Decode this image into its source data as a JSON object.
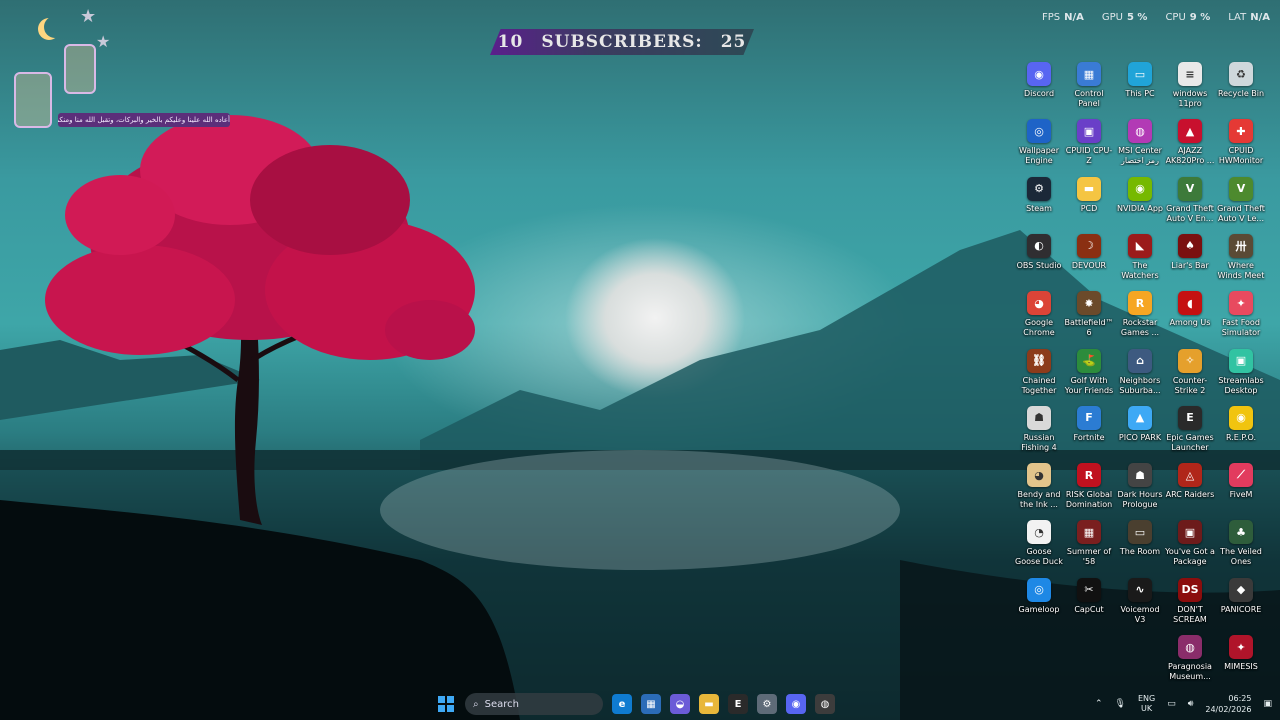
{
  "banner": {
    "count_left": "10",
    "title": "SUBSCRIBERS:",
    "count_right": "25"
  },
  "perf": [
    {
      "key": "FPS",
      "value": "N/A"
    },
    {
      "key": "GPU",
      "value": "5 %"
    },
    {
      "key": "CPU",
      "value": "9 %"
    },
    {
      "key": "LAT",
      "value": "N/A"
    }
  ],
  "greeting": "أعاده الله علينا وعليكم بالخير والبركات، وتقبل الله منا ومنكم",
  "desktop_icons": [
    {
      "label": "Discord",
      "icon": "discord-icon",
      "color": "#5865f2",
      "glyph": "◉"
    },
    {
      "label": "Control Panel",
      "icon": "control-panel-icon",
      "color": "#3a7bd5",
      "glyph": "▦"
    },
    {
      "label": "This PC",
      "icon": "monitor-icon",
      "color": "#20a4d8",
      "glyph": "▭"
    },
    {
      "label": "windows 11pro key.txt",
      "icon": "text-file-icon",
      "color": "#e9e9e9",
      "glyph": "≡"
    },
    {
      "label": "Recycle Bin",
      "icon": "recycle-bin-icon",
      "color": "#cfd8dc",
      "glyph": "♻"
    },
    {
      "label": "Wallpaper Engine",
      "icon": "wallpaper-engine-icon",
      "color": "#1e63c7",
      "glyph": "◎"
    },
    {
      "label": "CPUID CPU-Z",
      "icon": "cpuz-icon",
      "color": "#6a3fc8",
      "glyph": "▣"
    },
    {
      "label": "MSI Center رمز اختصار",
      "icon": "msi-center-icon",
      "color": "#b23ab5",
      "glyph": "◍"
    },
    {
      "label": "AJAZZ AK820Pro ...",
      "icon": "ajazz-icon",
      "color": "#c8102e",
      "glyph": "▲"
    },
    {
      "label": "CPUID HWMonitor",
      "icon": "hwmonitor-icon",
      "color": "#e53935",
      "glyph": "✚"
    },
    {
      "label": "Steam",
      "icon": "steam-icon",
      "color": "#1b2838",
      "glyph": "⚙"
    },
    {
      "label": "PCD",
      "icon": "folder-icon",
      "color": "#f5c542",
      "glyph": "▬"
    },
    {
      "label": "NVIDIA App",
      "icon": "nvidia-icon",
      "color": "#76b900",
      "glyph": "◉"
    },
    {
      "label": "Grand Theft Auto V En...",
      "icon": "gta-icon",
      "color": "#3d7a3a",
      "glyph": "V"
    },
    {
      "label": "Grand Theft Auto V Le...",
      "icon": "gta-legacy-icon",
      "color": "#4d8a2e",
      "glyph": "V"
    },
    {
      "label": "OBS Studio",
      "icon": "obs-icon",
      "color": "#302e31",
      "glyph": "◐"
    },
    {
      "label": "DEVOUR",
      "icon": "devour-icon",
      "color": "#8a2f12",
      "glyph": "☽"
    },
    {
      "label": "The Watchers",
      "icon": "watchers-icon",
      "color": "#9b1b1b",
      "glyph": "◣"
    },
    {
      "label": "Liar's Bar",
      "icon": "liars-bar-icon",
      "color": "#7a1010",
      "glyph": "♠"
    },
    {
      "label": "Where Winds Meet",
      "icon": "where-winds-meet-icon",
      "color": "#5a4a35",
      "glyph": "卅"
    },
    {
      "label": "Google Chrome",
      "icon": "chrome-icon",
      "color": "#db4437",
      "glyph": "◕"
    },
    {
      "label": "Battlefield™ 6",
      "icon": "battlefield-icon",
      "color": "#6b4a2a",
      "glyph": "✸"
    },
    {
      "label": "Rockstar Games ...",
      "icon": "rockstar-icon",
      "color": "#f6a623",
      "glyph": "R"
    },
    {
      "label": "Among Us",
      "icon": "among-us-icon",
      "color": "#c51111",
      "glyph": "◖"
    },
    {
      "label": "Fast Food Simulator",
      "icon": "fast-food-icon",
      "color": "#e84a5f",
      "glyph": "✦"
    },
    {
      "label": "Chained Together",
      "icon": "chained-together-icon",
      "color": "#8c3b1b",
      "glyph": "⛓"
    },
    {
      "label": "Golf With Your Friends",
      "icon": "golf-icon",
      "color": "#2c8c3c",
      "glyph": "⛳"
    },
    {
      "label": "Neighbors Suburba...",
      "icon": "neighbors-icon",
      "color": "#3d5a80",
      "glyph": "⌂"
    },
    {
      "label": "Counter-Strike 2",
      "icon": "cs2-icon",
      "color": "#e5a02c",
      "glyph": "✧"
    },
    {
      "label": "Streamlabs Desktop",
      "icon": "streamlabs-icon",
      "color": "#31c3a2",
      "glyph": "▣"
    },
    {
      "label": "Russian Fishing 4",
      "icon": "russian-fishing-icon",
      "color": "#d9d9d9",
      "glyph": "☗"
    },
    {
      "label": "Fortnite",
      "icon": "fortnite-icon",
      "color": "#2b7cd3",
      "glyph": "F"
    },
    {
      "label": "PICO PARK",
      "icon": "pico-park-icon",
      "color": "#3da9f5",
      "glyph": "▲"
    },
    {
      "label": "Epic Games Launcher",
      "icon": "epic-games-icon",
      "color": "#2a2a2a",
      "glyph": "E"
    },
    {
      "label": "R.E.P.O.",
      "icon": "repo-icon",
      "color": "#f1c40f",
      "glyph": "◉"
    },
    {
      "label": "Bendy and the Ink ...",
      "icon": "bendy-icon",
      "color": "#e2c48b",
      "glyph": "◕"
    },
    {
      "label": "RISK Global Domination",
      "icon": "risk-icon",
      "color": "#c0111f",
      "glyph": "R"
    },
    {
      "label": "Dark Hours Prologue",
      "icon": "dark-hours-icon",
      "color": "#444",
      "glyph": "☗"
    },
    {
      "label": "ARC Raiders",
      "icon": "arc-raiders-icon",
      "color": "#b0261a",
      "glyph": "◬"
    },
    {
      "label": "FiveM",
      "icon": "fivem-icon",
      "color": "#e23b5e",
      "glyph": "⟋"
    },
    {
      "label": "Goose Goose Duck",
      "icon": "goose-goose-duck-icon",
      "color": "#f2f2f2",
      "glyph": "◔"
    },
    {
      "label": "Summer of '58",
      "icon": "summer-58-icon",
      "color": "#7a1f1f",
      "glyph": "▦"
    },
    {
      "label": "The Room",
      "icon": "the-room-icon",
      "color": "#4a3f2f",
      "glyph": "▭"
    },
    {
      "label": "You've Got a Package",
      "icon": "package-icon",
      "color": "#6d1b1b",
      "glyph": "▣"
    },
    {
      "label": "The Veiled Ones",
      "icon": "veiled-ones-icon",
      "color": "#2e5d3b",
      "glyph": "♣"
    },
    {
      "label": "Gameloop",
      "icon": "gameloop-icon",
      "color": "#1e88e5",
      "glyph": "◎"
    },
    {
      "label": "CapCut",
      "icon": "capcut-icon",
      "color": "#111111",
      "glyph": "✂"
    },
    {
      "label": "Voicemod V3",
      "icon": "voicemod-icon",
      "color": "#1a1a1a",
      "glyph": "∿"
    },
    {
      "label": "DON'T SCREAM",
      "icon": "dont-scream-icon",
      "color": "#8b0d0d",
      "glyph": "DS"
    },
    {
      "label": "PANICORE",
      "icon": "panicore-icon",
      "color": "#3a3a3a",
      "glyph": "◆"
    },
    {
      "label": "Paragnosia Museum...",
      "icon": "paragnosia-icon",
      "color": "#8a2d6a",
      "glyph": "◍"
    },
    {
      "label": "MIMESIS",
      "icon": "mimesis-icon",
      "color": "#b0142a",
      "glyph": "✦"
    }
  ],
  "taskbar": {
    "search_placeholder": "Search",
    "apps": [
      {
        "icon": "edge-icon",
        "color": "#0f7bd0",
        "glyph": "e"
      },
      {
        "icon": "microsoft-store-icon",
        "color": "#2b6cb8",
        "glyph": "▦"
      },
      {
        "icon": "copilot-icon",
        "color": "#6b5bd7",
        "glyph": "◒"
      },
      {
        "icon": "file-explorer-icon",
        "color": "#e8b73a",
        "glyph": "▬"
      },
      {
        "icon": "epic-games-taskbar-icon",
        "color": "#2a2a2a",
        "glyph": "E"
      },
      {
        "icon": "settings-icon",
        "color": "#5e6b78",
        "glyph": "⚙"
      },
      {
        "icon": "discord-taskbar-icon",
        "color": "#5865f2",
        "glyph": "◉"
      },
      {
        "icon": "recording-app-icon",
        "color": "#3c3c3c",
        "glyph": "◍"
      }
    ],
    "lang": {
      "top": "ENG",
      "bottom": "UK"
    },
    "time": "06:25",
    "date": "24/02/2026"
  }
}
